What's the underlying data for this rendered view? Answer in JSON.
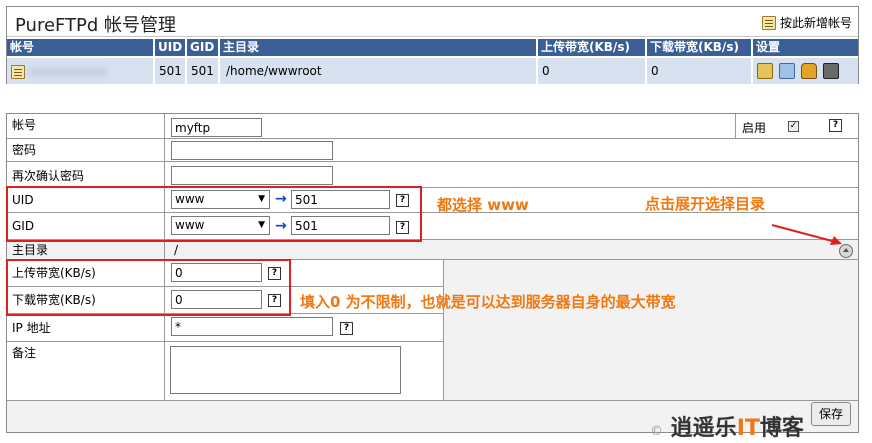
{
  "top": {
    "title": "PureFTPd 帐号管理",
    "add_label": "按此新增帐号",
    "headers": [
      "帐号",
      "UID",
      "GID",
      "主目录",
      "上传带宽(KB/s)",
      "下载带宽(KB/s)",
      "设置"
    ],
    "row": {
      "uid": "501",
      "gid": "501",
      "home": "/home/wwwroot",
      "up": "0",
      "down": "0"
    }
  },
  "form": {
    "account_label": "帐号",
    "account_value": "myftp",
    "enable_label": "启用",
    "password_label": "密码",
    "confirm_label": "再次确认密码",
    "uid_label": "UID",
    "uid_select": "www",
    "uid_value": "501",
    "gid_label": "GID",
    "gid_select": "www",
    "gid_value": "501",
    "home_label": "主目录",
    "home_value": "/",
    "up_label": "上传带宽(KB/s)",
    "up_value": "0",
    "down_label": "下载带宽(KB/s)",
    "down_value": "0",
    "ip_label": "IP 地址",
    "ip_value": "*",
    "note_label": "备注",
    "save_label": "保存"
  },
  "annotations": {
    "select_www": "都选择 www",
    "expand_dir": "点击展开选择目录",
    "fill_zero": "填入0 为不限制，也就是可以达到服务器自身的最大带宽"
  },
  "watermark": {
    "copy": "©",
    "brand": "逍遥乐",
    "it": "IT",
    "tail": "博客"
  },
  "colors": {
    "header_bg": "#3a5f96",
    "row_bg": "#d7e1ef",
    "annotation": "#f07810",
    "highlight": "#e02020"
  }
}
